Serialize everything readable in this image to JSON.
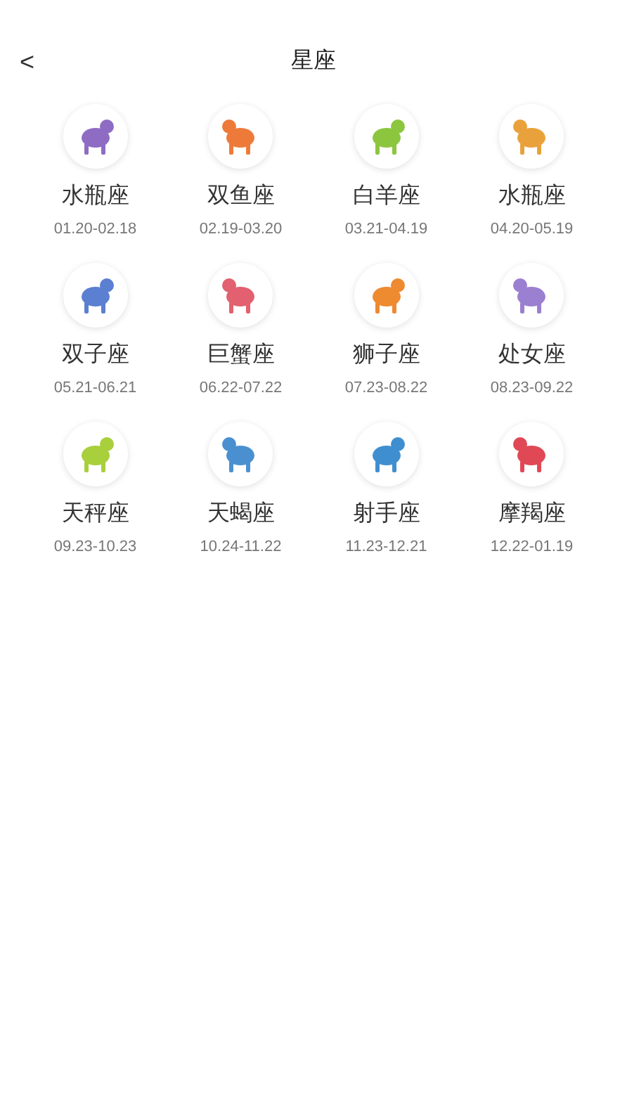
{
  "header": {
    "back": "<",
    "title": "星座"
  },
  "signs": [
    {
      "name": "水瓶座",
      "dates": "01.20-02.18",
      "color": "#8e6cc4"
    },
    {
      "name": "双鱼座",
      "dates": "02.19-03.20",
      "color": "#ee7a3a"
    },
    {
      "name": "白羊座",
      "dates": "03.21-04.19",
      "color": "#8cc63f"
    },
    {
      "name": "水瓶座",
      "dates": "04.20-05.19",
      "color": "#e9a23b"
    },
    {
      "name": "双子座",
      "dates": "05.21-06.21",
      "color": "#5b7fd1"
    },
    {
      "name": "巨蟹座",
      "dates": "06.22-07.22",
      "color": "#e2606f"
    },
    {
      "name": "狮子座",
      "dates": "07.23-08.22",
      "color": "#ee8a2f"
    },
    {
      "name": "处女座",
      "dates": "08.23-09.22",
      "color": "#9b7fd0"
    },
    {
      "name": "天秤座",
      "dates": "09.23-10.23",
      "color": "#a8cf3c"
    },
    {
      "name": "天蝎座",
      "dates": "10.24-11.22",
      "color": "#4a90d0"
    },
    {
      "name": "射手座",
      "dates": "11.23-12.21",
      "color": "#3f8fd0"
    },
    {
      "name": "摩羯座",
      "dates": "12.22-01.19",
      "color": "#e04855"
    }
  ]
}
